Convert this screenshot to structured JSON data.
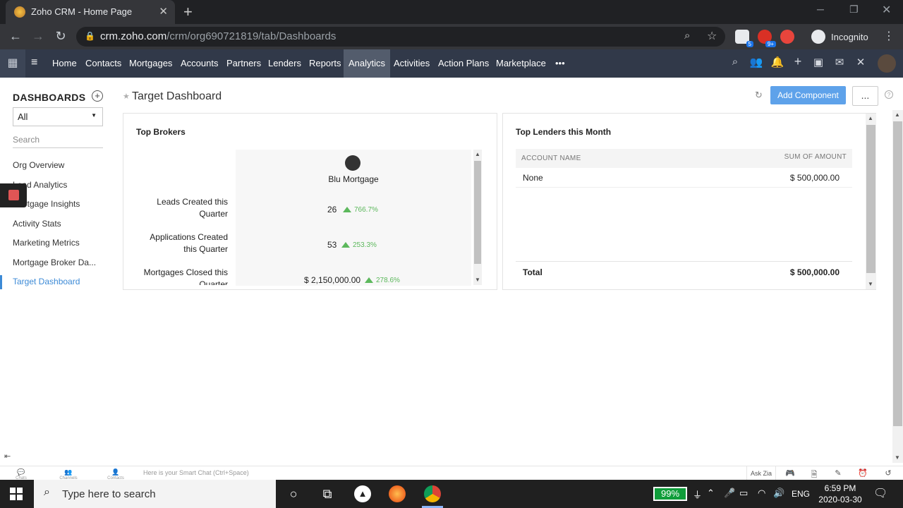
{
  "browser": {
    "tab_title": "Zoho CRM - Home Page",
    "tab_close": "✕",
    "new_tab": "+",
    "url_host": "crm.zoho.com",
    "url_path": "/crm/org690721819/tab/Dashboards",
    "incognito_label": "Incognito",
    "ext_badges": [
      "5",
      "9+"
    ]
  },
  "zoho_nav": {
    "items": [
      "Home",
      "Contacts",
      "Mortgages",
      "Accounts",
      "Partners",
      "Lenders",
      "Reports",
      "Analytics",
      "Activities",
      "Action Plans",
      "Marketplace"
    ],
    "active": "Analytics",
    "more": "•••"
  },
  "sidebar": {
    "heading": "DASHBOARDS",
    "filter_value": "All",
    "search_placeholder": "Search",
    "items": [
      "Org Overview",
      "Lead Analytics",
      "Mortgage Insights",
      "Activity Stats",
      "Marketing Metrics",
      "Mortgage Broker Da...",
      "Target Dashboard"
    ],
    "selected": "Target Dashboard"
  },
  "main": {
    "title": "Target Dashboard",
    "add_component": "Add Component",
    "more_btn": "..."
  },
  "top_brokers": {
    "title": "Top Brokers",
    "broker_name": "Blu Mortgage",
    "rows": [
      {
        "label": "Leads Created this Quarter",
        "value": "26",
        "change": "766.7%"
      },
      {
        "label": "Applications Created this Quarter",
        "value": "53",
        "change": "253.3%"
      },
      {
        "label": "Mortgages Closed this Quarter",
        "value": "$ 2,150,000.00",
        "change": "278.6%"
      }
    ]
  },
  "top_lenders": {
    "title": "Top Lenders this Month",
    "col_account": "ACCOUNT NAME",
    "col_sum": "SUM OF AMOUNT",
    "rows": [
      {
        "account": "None",
        "amount": "$ 500,000.00"
      }
    ],
    "total_label": "Total",
    "total_value": "$ 500,000.00"
  },
  "zoho_bottom": {
    "chats": "Chats",
    "channels": "Channels",
    "contacts": "Contacts",
    "smart_chat": "Here is your Smart Chat (Ctrl+Space)",
    "ask_zia": "Ask Zia"
  },
  "taskbar": {
    "search_placeholder": "Type here to search",
    "battery": "99%",
    "language": "ENG",
    "time": "6:59 PM",
    "date": "2020-03-30"
  },
  "colors": {
    "nav_bg": "#313949",
    "accent": "#3c8ad6",
    "add_button": "#5ea2ea",
    "positive": "#5cb85c"
  }
}
